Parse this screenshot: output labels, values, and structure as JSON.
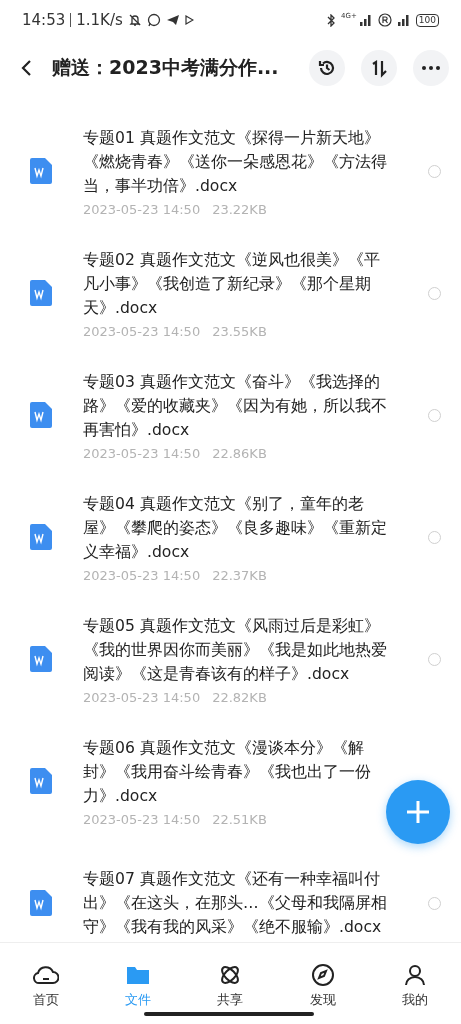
{
  "status_bar": {
    "time": "14:53",
    "speed": "1.1K/s",
    "network": "4G+",
    "battery": "100"
  },
  "header": {
    "title": "赠送：2023中考满分作..."
  },
  "files": [
    {
      "name": "专题01 真题作文范文《探得一片新天地》《燃烧青春》《送你一朵感恩花》《方法得当，事半功倍》.docx",
      "date": "2023-05-23  14:50",
      "size": "23.22KB",
      "selected": false
    },
    {
      "name": "专题02 真题作文范文《逆风也很美》《平凡小事》《我创造了新纪录》《那个星期天》.docx",
      "date": "2023-05-23  14:50",
      "size": "23.55KB",
      "selected": false
    },
    {
      "name": "专题03 真题作文范文《奋斗》《我选择的路》《爱的收藏夹》《因为有她，所以我不再害怕》.docx",
      "date": "2023-05-23  14:50",
      "size": "22.86KB",
      "selected": false
    },
    {
      "name": "专题04 真题作文范文《别了，童年的老屋》《攀爬的姿态》《良多趣味》《重新定义幸福》.docx",
      "date": "2023-05-23  14:50",
      "size": "22.37KB",
      "selected": false
    },
    {
      "name": "专题05 真题作文范文《风雨过后是彩虹》《我的世界因你而美丽》《我是如此地热爱阅读》《这是青春该有的样子》.docx",
      "date": "2023-05-23  14:50",
      "size": "22.82KB",
      "selected": false
    },
    {
      "name": "专题06 真题作文范文《漫谈本分》《解封》《我用奋斗绘青春》《我也出了一份力》.docx",
      "date": "2023-05-23  14:50",
      "size": "22.51KB"
    },
    {
      "name": "专题07 真题作文范文《还有一种幸福叫付出》《在这头，在那头…《父母和我隔屏相守》《我有我的风采》《绝不服输》.docx",
      "selected": false
    }
  ],
  "nav": [
    {
      "label": "首页",
      "kind": "home",
      "selected": false
    },
    {
      "label": "文件",
      "kind": "files",
      "selected": true
    },
    {
      "label": "共享",
      "kind": "share",
      "selected": false
    },
    {
      "label": "发现",
      "kind": "discover",
      "selected": false
    },
    {
      "label": "我的",
      "kind": "me",
      "selected": false
    }
  ]
}
